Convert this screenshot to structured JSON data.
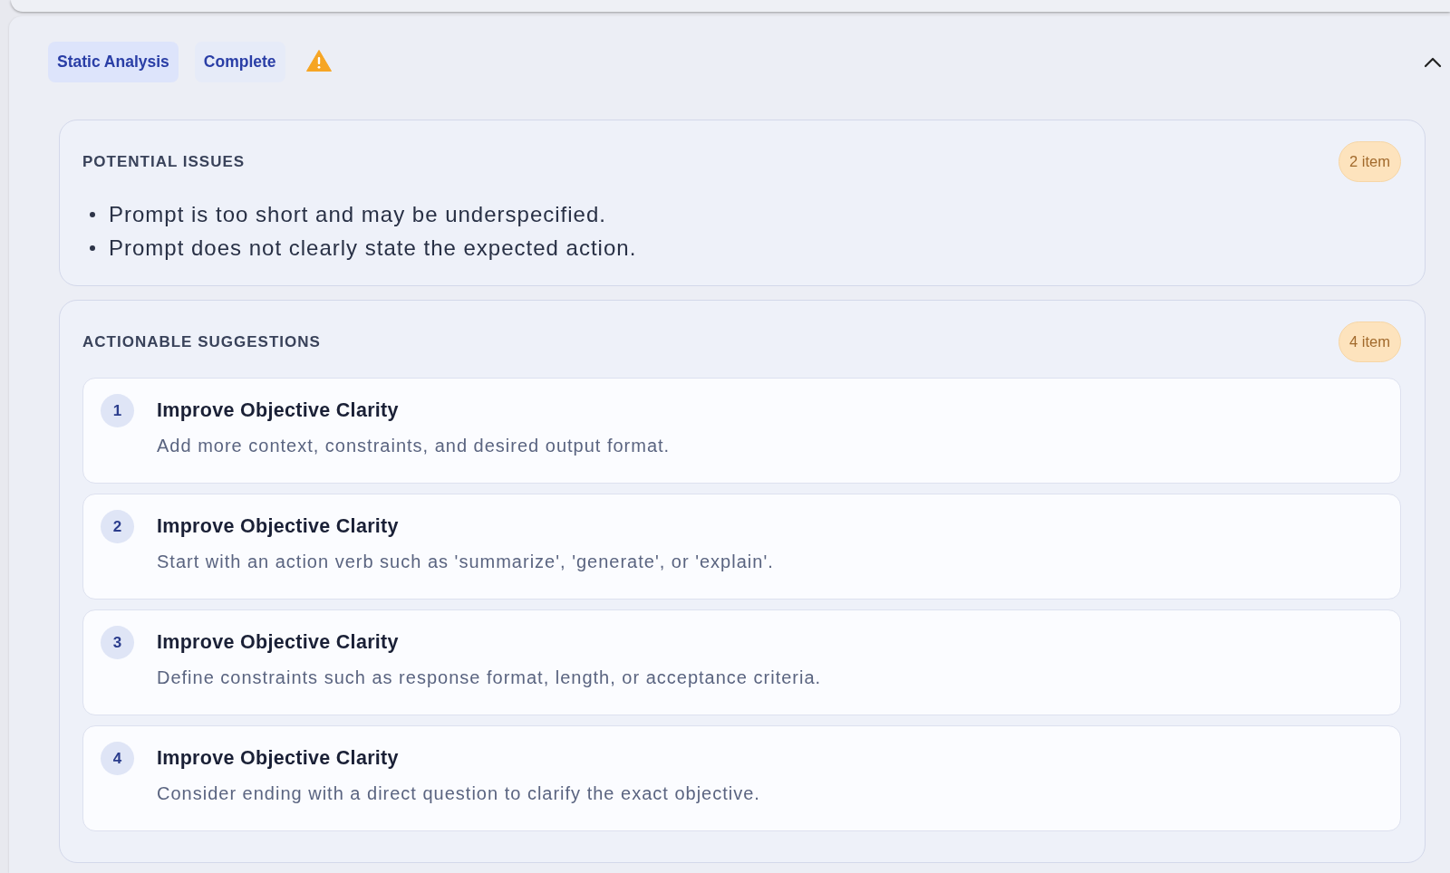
{
  "header": {
    "stage": "Static Analysis",
    "status": "Complete",
    "warning": true,
    "expanded": true
  },
  "sections": [
    {
      "kind": "bullets",
      "title": "POTENTIAL ISSUES",
      "count": "2 item",
      "items": [
        "Prompt is too short and may be underspecified.",
        "Prompt does not clearly state the expected action."
      ]
    },
    {
      "kind": "steps",
      "title": "ACTIONABLE SUGGESTIONS",
      "count": "4 item",
      "items": [
        {
          "number": "1",
          "title": "Improve Objective Clarity",
          "description": "Add more context, constraints, and desired output format."
        },
        {
          "number": "2",
          "title": "Improve Objective Clarity",
          "description": "Start with an action verb such as 'summarize', 'generate', or 'explain'."
        },
        {
          "number": "3",
          "title": "Improve Objective Clarity",
          "description": "Define constraints such as response format, length, or acceptance criteria."
        },
        {
          "number": "4",
          "title": "Improve Objective Clarity",
          "description": "Consider ending with a direct question to clarify the exact objective."
        }
      ]
    }
  ]
}
